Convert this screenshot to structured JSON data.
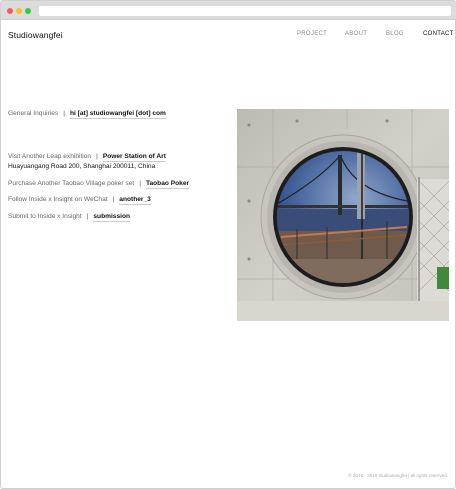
{
  "site": {
    "brand": "Studiowangfei"
  },
  "nav": [
    "PROJECT",
    "ABOUT",
    "BLOG",
    "CONTACT"
  ],
  "contact": {
    "inquiries_label": "General Inquiries",
    "inquiries_link": "hi [at] studiowangfei [dot] com",
    "visit_label": "Visit Another Leap exhibition",
    "visit_link": "Power Station of Art",
    "address": "Huayuangang Road 200, Shanghai 200011, China",
    "purchase_label": "Purchase Another Taobao Village poker set",
    "purchase_link": "Taobao Poker",
    "follow_label": "Follow Inside x Insight on WeChat",
    "follow_link": "another_3",
    "submit_label": "Submit to Inside x Insight",
    "submit_link": "submission",
    "separator": "|"
  },
  "footer": {
    "text": "© 2016 - 2019 studiowangfei | all rights reserved."
  },
  "colors": {
    "accent_text": "#111111",
    "muted_text": "#666666",
    "chrome": "#dcdcdc"
  }
}
